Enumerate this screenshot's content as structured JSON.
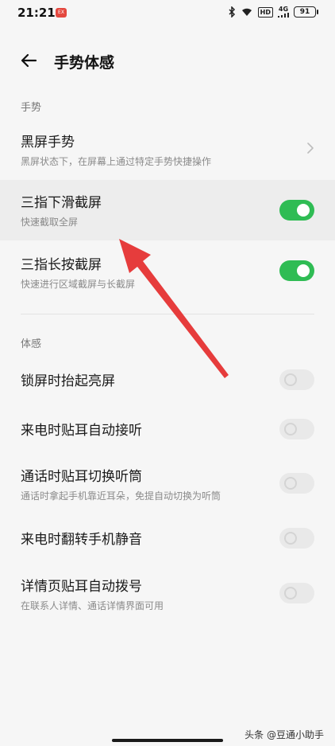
{
  "status": {
    "time": "21:21",
    "rec_badge": "EX",
    "network_label": "4G",
    "hd_label": "HD",
    "battery": "91"
  },
  "header": {
    "title": "手势体感"
  },
  "sections": {
    "gestures_label": "手势",
    "motion_label": "体感"
  },
  "items": {
    "black_screen": {
      "title": "黑屏手势",
      "subtitle": "黑屏状态下，在屏幕上通过特定手势快捷操作"
    },
    "three_finger_swipe": {
      "title": "三指下滑截屏",
      "subtitle": "快速截取全屏",
      "on": true
    },
    "three_finger_hold": {
      "title": "三指长按截屏",
      "subtitle": "快速进行区域截屏与长截屏",
      "on": true
    },
    "raise_to_wake": {
      "title": "锁屏时抬起亮屏",
      "on": false
    },
    "ear_answer": {
      "title": "来电时贴耳自动接听",
      "on": false
    },
    "ear_switch": {
      "title": "通话时贴耳切换听筒",
      "subtitle": "通话时拿起手机靠近耳朵，免提自动切换为听筒",
      "on": false
    },
    "flip_mute": {
      "title": "来电时翻转手机静音",
      "on": false
    },
    "ear_dial": {
      "title": "详情页贴耳自动拨号",
      "subtitle": "在联系人详情、通话详情界面可用",
      "on": false
    }
  },
  "watermark": "头条 @豆通小助手",
  "colors": {
    "toggle_on": "#2fbc54",
    "annotation_arrow": "#e63c3c"
  }
}
